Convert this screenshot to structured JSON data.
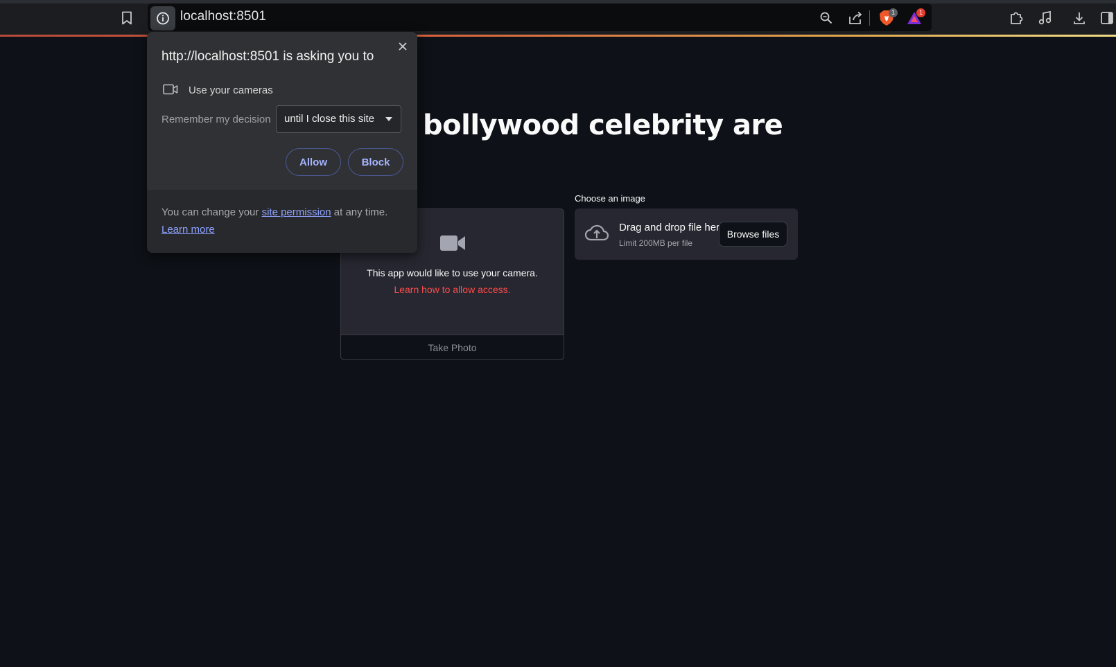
{
  "browser": {
    "url": "localhost:8501",
    "extensions": {
      "brave_shields_badge": "1",
      "rewards_badge": "1"
    }
  },
  "page": {
    "title": "bollywood celebrity are",
    "camera": {
      "message": "This app would like to use your camera.",
      "link": "Learn how to allow access.",
      "take_photo_label": "Take Photo"
    },
    "uploader": {
      "label": "Choose an image",
      "drop_text": "Drag and drop file here",
      "limit_text": "Limit 200MB per file",
      "browse_label": "Browse files"
    }
  },
  "permission_popup": {
    "title": "http://localhost:8501 is asking you to",
    "permission": "Use your cameras",
    "remember_label": "Remember my decision",
    "remember_value": "until I close this site",
    "allow_label": "Allow",
    "block_label": "Block",
    "footer_prefix": "You can change your ",
    "footer_link": "site permission",
    "footer_suffix": " at any time.",
    "learn_more": "Learn more"
  },
  "colors": {
    "page_bg": "#0e1117",
    "widget_bg": "#262730",
    "error_red": "#ff4b4b",
    "popup_bg": "#2f3134",
    "popup_link": "#8fa2ff"
  }
}
